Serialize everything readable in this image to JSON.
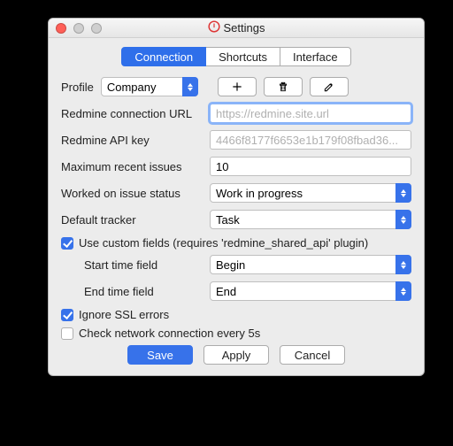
{
  "window": {
    "title": "Settings"
  },
  "tabs": {
    "connection": "Connection",
    "shortcuts": "Shortcuts",
    "interface": "Interface"
  },
  "profile": {
    "label": "Profile",
    "value": "Company"
  },
  "fields": {
    "url": {
      "label": "Redmine connection URL",
      "placeholder": "https://redmine.site.url",
      "value": ""
    },
    "api": {
      "label": "Redmine API key",
      "placeholder": "4466f8177f6653e1b179f08fbad36...",
      "value": ""
    },
    "max": {
      "label": "Maximum recent issues",
      "value": "10"
    },
    "status": {
      "label": "Worked on issue status",
      "value": "Work in progress"
    },
    "tracker": {
      "label": "Default tracker",
      "value": "Task"
    }
  },
  "customFields": {
    "checkbox": "Use custom fields (requires 'redmine_shared_api' plugin)",
    "start": {
      "label": "Start time field",
      "value": "Begin"
    },
    "end": {
      "label": "End time field",
      "value": "End"
    }
  },
  "ignoreSSL": "Ignore SSL errors",
  "checkNetwork": "Check network connection every 5s",
  "buttons": {
    "save": "Save",
    "apply": "Apply",
    "cancel": "Cancel"
  }
}
